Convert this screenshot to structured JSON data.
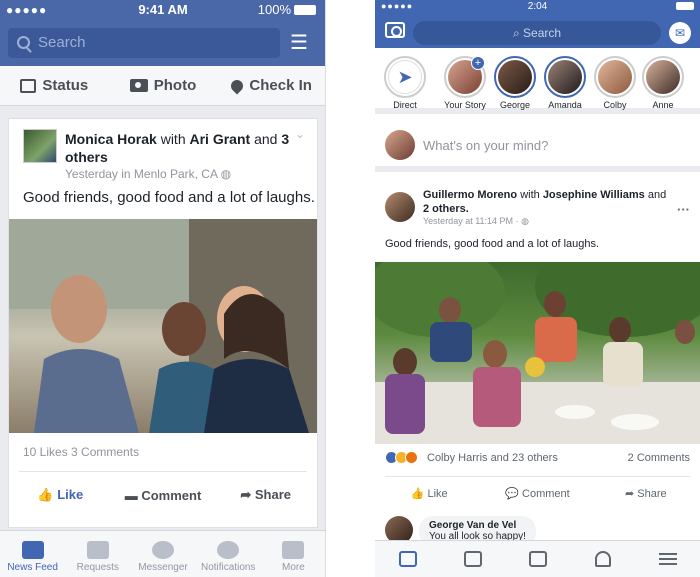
{
  "left": {
    "status": {
      "carrier_dots": "●●●●●",
      "time": "9:41 AM",
      "battery": "100%"
    },
    "search": {
      "placeholder": "Search"
    },
    "composer": {
      "status": "Status",
      "photo": "Photo",
      "checkin": "Check In"
    },
    "post": {
      "author": "Monica Horak",
      "with_text": "with",
      "tagged": "Ari Grant",
      "and_text": "and",
      "others": "3 others",
      "meta": "Yesterday in Menlo Park, CA",
      "text": "Good friends, good food and a lot of laughs.",
      "likes": "10 Likes",
      "comments": "3 Comments",
      "actions": {
        "like": "Like",
        "comment": "Comment",
        "share": "Share"
      }
    },
    "tabs": [
      {
        "label": "News Feed",
        "icon": "news-feed-icon"
      },
      {
        "label": "Requests",
        "icon": "friends-icon"
      },
      {
        "label": "Messenger",
        "icon": "messenger-icon"
      },
      {
        "label": "Notifications",
        "icon": "globe-icon"
      },
      {
        "label": "More",
        "icon": "menu-icon"
      }
    ]
  },
  "right": {
    "status": {
      "carrier_dots": "●●●●●",
      "time": "2:04"
    },
    "search": {
      "placeholder": "Search"
    },
    "stories": [
      {
        "label": "Direct"
      },
      {
        "label": "Your Story"
      },
      {
        "label": "George"
      },
      {
        "label": "Amanda"
      },
      {
        "label": "Colby"
      },
      {
        "label": "Anne"
      }
    ],
    "composer": {
      "placeholder": "What's on your mind?"
    },
    "post": {
      "author": "Guillermo Moreno",
      "with_text": "with",
      "tagged": "Josephine Williams",
      "and_text": "and",
      "others": "2 others.",
      "meta": "Yesterday at 11:14 PM · ",
      "text": "Good friends, good food and a lot of laughs.",
      "reactions_text": "Colby Harris and 23 others",
      "comments": "2 Comments",
      "actions": {
        "like": "Like",
        "comment": "Comment",
        "share": "Share"
      }
    },
    "comment": {
      "author": "George Van de Vel",
      "text": "You all look so happy!"
    }
  },
  "colors": {
    "brand": "#4267b2",
    "brand_old": "#4a68a8"
  }
}
